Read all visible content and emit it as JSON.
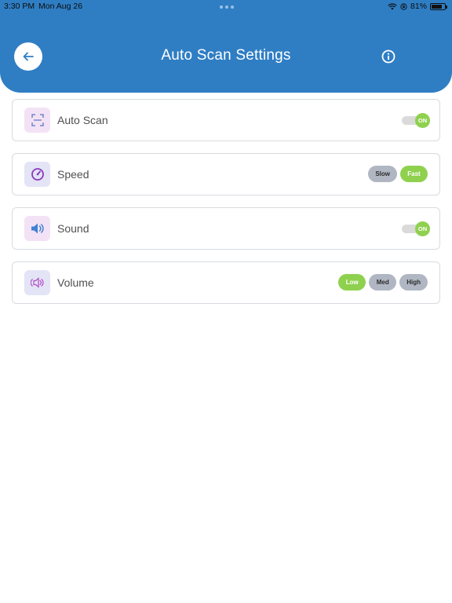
{
  "status_bar": {
    "time": "3:30 PM",
    "date": "Mon Aug 26",
    "battery": "81%",
    "battery_level": 0.81
  },
  "header": {
    "title": "Auto Scan Settings",
    "back_icon": "arrow-left-icon",
    "info_icon": "info-circle-icon",
    "color": "#2f7ec4"
  },
  "settings": {
    "auto_scan": {
      "label": "Auto Scan",
      "icon": "scan-frame-icon",
      "toggle": "ON",
      "on": true
    },
    "speed": {
      "label": "Speed",
      "icon": "speedometer-icon",
      "options": [
        "Slow",
        "Fast"
      ],
      "selected": "Fast"
    },
    "sound": {
      "label": "Sound",
      "icon": "speaker-icon",
      "toggle": "ON",
      "on": true
    },
    "volume": {
      "label": "Volume",
      "icon": "volume-icon",
      "options": [
        "Low",
        "Med",
        "High"
      ],
      "selected": "Low"
    }
  },
  "colors": {
    "active": "#8fd14f",
    "inactive": "#b0b7c3",
    "icon_bg_pink": "#f3e2f5",
    "icon_bg_lavender": "#e4e4f7"
  }
}
